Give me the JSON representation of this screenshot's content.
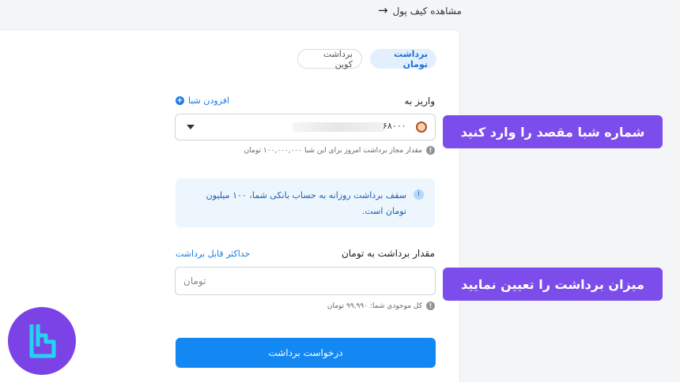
{
  "header": {
    "back_label": "مشاهده کیف پول"
  },
  "tabs": [
    {
      "label": "برداشت تومان",
      "active": true
    },
    {
      "label": "برداشت کوین",
      "active": false
    }
  ],
  "deposit": {
    "label": "واریز به",
    "add_sheba_label": "افزودن شبا",
    "sheba_suffix": "۶۸۰۰۰",
    "hint": "مقدار مجاز برداشت امروز برای این شبا ۱۰۰,۰۰۰,۰۰۰ تومان"
  },
  "notice": {
    "text": "سقف برداشت روزانه به حساب بانکی شما، ۱۰۰ میلیون تومان است."
  },
  "amount": {
    "label": "مقدار برداشت به تومان",
    "max_label": "حداکثر قابل برداشت",
    "placeholder": "تومان",
    "balance_hint": "کل موجودی شما: ۹۹,۹۹۰ تومان"
  },
  "submit_label": "درخواست برداشت",
  "callouts": {
    "sheba": "شماره شبا مقصد را وارد کنید",
    "amount": "میزان برداشت را تعیین نمایید"
  },
  "colors": {
    "accent": "#1488f2",
    "callout": "#7c4dea",
    "notice_bg": "#eef6fd"
  }
}
